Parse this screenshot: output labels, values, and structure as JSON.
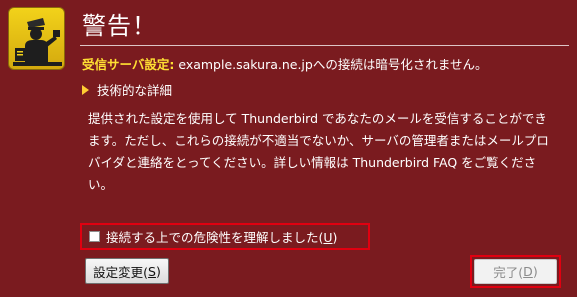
{
  "dialog": {
    "title": "警告！",
    "warning_label": "受信サーバ設定:",
    "warning_text": " example.sakura.ne.jpへの接続は暗号化されません。",
    "details_label": "技術的な詳細",
    "body": "提供された設定を使用して Thunderbird であなたのメールを受信することができます。ただし、これらの接続が不適当でないか、サーバの管理者またはメールプロバイダと連絡をとってください。詳しい情報は Thunderbird FAQ をご覧ください。",
    "checkbox_label": "接続する上での危険性を理解しました(",
    "checkbox_accel": "U",
    "checkbox_close": ")",
    "checkbox_checked": false,
    "settings_button": "設定変更(",
    "settings_accel": "S",
    "settings_close": ")",
    "done_button": "完了(",
    "done_accel": "D",
    "done_close": ")",
    "done_enabled": false
  },
  "icons": {
    "warning_icon": "customs-officer-icon",
    "details_toggle": "triangle-right-icon"
  },
  "colors": {
    "background": "#7a1b1f",
    "label": "#ffe033",
    "highlight": "#e00010",
    "icon_bg": "#f2d21a"
  }
}
